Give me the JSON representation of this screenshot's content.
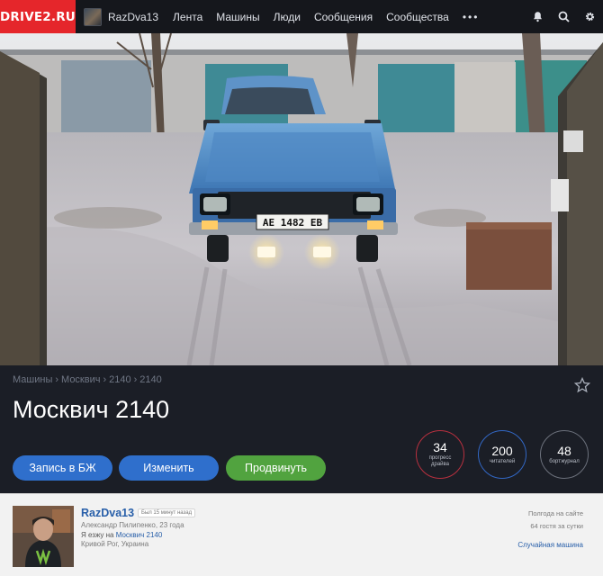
{
  "nav": {
    "logo": "DRIVE2.RU",
    "username": "RazDva13",
    "links": [
      "Лента",
      "Машины",
      "Люди",
      "Сообщения",
      "Сообщества"
    ],
    "more": "•••",
    "icons": [
      "bell-icon",
      "search-icon",
      "gear-icon"
    ]
  },
  "hero": {
    "plate": "AE 1482 EB"
  },
  "car": {
    "breadcrumb": [
      "Машины",
      "Москвич",
      "2140",
      "2140"
    ],
    "title": "Москвич 2140",
    "buttons": {
      "journal": "Запись в БЖ",
      "edit": "Изменить",
      "promote": "Продвинуть"
    },
    "stats": [
      {
        "value": "34",
        "label": "прогресс драйва",
        "color": "#b8303f"
      },
      {
        "value": "200",
        "label": "читателей",
        "color": "#3267c4"
      },
      {
        "value": "48",
        "label": "бортжурнал",
        "color": "#6c717c"
      }
    ]
  },
  "owner": {
    "name": "RazDva13",
    "online_badge": "Был 15 минут назад",
    "full_name": "Александр Пилипенко, 23 года",
    "drive_prefix": "Я езжу на",
    "drive_car": "Москвич 2140",
    "city": "Кривой Рог, Украина",
    "seen": "Полгода на сайте",
    "guests": "64 гостя за сутки",
    "random_car": "Случайная машина"
  },
  "colors": {
    "brand": "#e5262b",
    "button_blue": "#2f6fcc",
    "button_green": "#51a33f"
  }
}
